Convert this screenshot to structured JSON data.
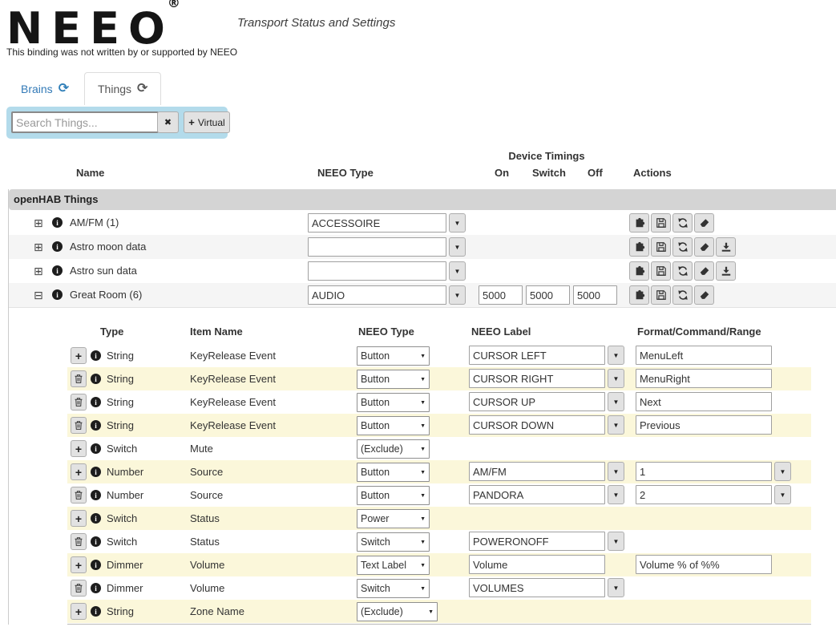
{
  "header": {
    "logo": "NEEO",
    "registered": "®",
    "subtitle": "Transport Status and Settings",
    "disclaimer": "This binding was not written by or supported by NEEO"
  },
  "tabs": {
    "brains": "Brains",
    "things": "Things"
  },
  "search": {
    "placeholder": "Search Things...",
    "virtual_label": "Virtual"
  },
  "icons": {
    "expand": "⊞",
    "collapse": "⊟",
    "caret": "▼",
    "refresh": "⟳",
    "close": "✖",
    "plus": "+",
    "info": "i"
  },
  "colors": {
    "link_blue": "#337ab7",
    "panel_blue": "#b3dbeb",
    "row_alt_gray": "#f5f5f5",
    "row_yellow": "#fbf7da",
    "group_gray": "#d4d4d4"
  },
  "things": {
    "group_header": "openHAB Things",
    "columns": {
      "name": "Name",
      "neeo_type": "NEEO Type",
      "device_timings": "Device Timings",
      "on": "On",
      "switch": "Switch",
      "off": "Off",
      "actions": "Actions"
    },
    "rows": [
      {
        "name": "AM/FM (1)",
        "neeo_type": "ACCESSOIRE"
      },
      {
        "name": "Astro moon data",
        "neeo_type": ""
      },
      {
        "name": "Astro sun data",
        "neeo_type": ""
      },
      {
        "name": "Great Room (6)",
        "neeo_type": "AUDIO",
        "timing_on": "5000",
        "timing_switch": "5000",
        "timing_off": "5000"
      }
    ]
  },
  "channels": {
    "columns": {
      "type": "Type",
      "item_name": "Item Name",
      "neeo_type": "NEEO Type",
      "neeo_label": "NEEO Label",
      "format": "Format/Command/Range"
    },
    "rows": [
      {
        "type": "String",
        "item": "KeyRelease Event",
        "neeo_type": "Button",
        "label": "CURSOR LEFT",
        "format": "MenuLeft"
      },
      {
        "type": "String",
        "item": "KeyRelease Event",
        "neeo_type": "Button",
        "label": "CURSOR RIGHT",
        "format": "MenuRight"
      },
      {
        "type": "String",
        "item": "KeyRelease Event",
        "neeo_type": "Button",
        "label": "CURSOR UP",
        "format": "Next"
      },
      {
        "type": "String",
        "item": "KeyRelease Event",
        "neeo_type": "Button",
        "label": "CURSOR DOWN",
        "format": "Previous"
      },
      {
        "type": "Switch",
        "item": "Mute",
        "neeo_type": "(Exclude)"
      },
      {
        "type": "Number",
        "item": "Source",
        "neeo_type": "Button",
        "label": "AM/FM",
        "format": "1"
      },
      {
        "type": "Number",
        "item": "Source",
        "neeo_type": "Button",
        "label": "PANDORA",
        "format": "2"
      },
      {
        "type": "Switch",
        "item": "Status",
        "neeo_type": "Power"
      },
      {
        "type": "Switch",
        "item": "Status",
        "neeo_type": "Switch",
        "label": "POWERONOFF"
      },
      {
        "type": "Dimmer",
        "item": "Volume",
        "neeo_type": "Text Label",
        "label": "Volume",
        "format": "Volume % of %%"
      },
      {
        "type": "Dimmer",
        "item": "Volume",
        "neeo_type": "Switch",
        "label": "VOLUMES"
      },
      {
        "type": "String",
        "item": "Zone Name",
        "neeo_type": "(Exclude)"
      }
    ]
  }
}
